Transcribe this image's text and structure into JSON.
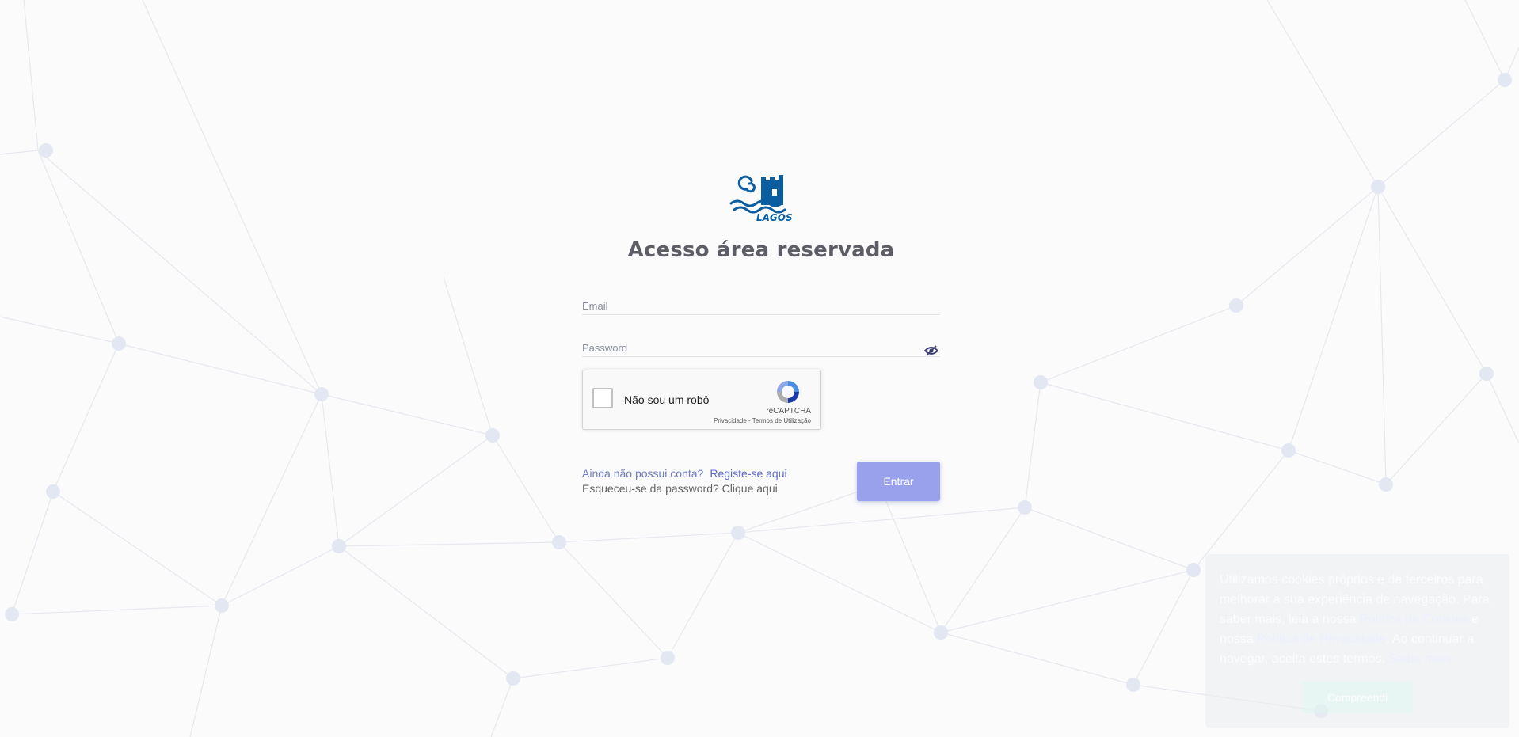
{
  "header": {
    "logo_text": "LAGOS",
    "title": "Acesso área reservada"
  },
  "form": {
    "email_label": "Email",
    "password_label": "Password",
    "recaptcha": {
      "label": "Não sou um robô",
      "brand": "reCAPTCHA",
      "terms": "Privacidade - Termos de Utilização"
    },
    "no_account_question": "Ainda não possui conta?",
    "register_link": "Registe-se aqui",
    "forgot_question": "Esqueceu-se da password?",
    "forgot_link": "Clique aqui",
    "submit_label": "Entrar"
  },
  "cookie_banner": {
    "text_1": "Utilizamos cookies próprios e de terceiros para melhorar a sua experiência de navegação. Para saber mais, leia a nossa",
    "policy_link": "Política de Cookies",
    "text_2": "e nossa",
    "privacy_link": "Política de Privacidade",
    "text_3": ". Ao continuar a navegar, aceita estes termos.",
    "learn_more_link": "Saiba mais",
    "accept_label": "Compreendi"
  },
  "colors": {
    "accent": "#5b69c9",
    "button": "#9aa1ec",
    "title": "#5d5d66",
    "logo": "#0a5ea0"
  }
}
